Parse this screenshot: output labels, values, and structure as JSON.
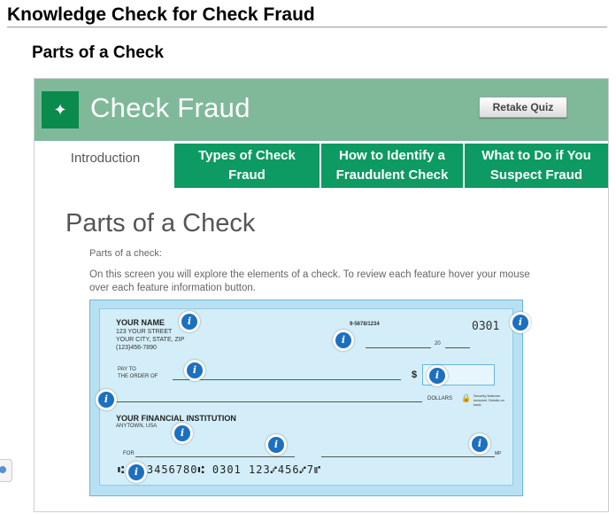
{
  "page": {
    "heading": "Knowledge Check for Check Fraud",
    "section_title": "Parts of a Check"
  },
  "banner": {
    "title": "Check Fraud",
    "retake_label": "Retake Quiz",
    "logo_icon": "bank-logo-icon",
    "color": "#7fb99a"
  },
  "tabs": [
    {
      "label": "Introduction",
      "active": true
    },
    {
      "label": "Types of Check Fraud",
      "active": false
    },
    {
      "label": "How to Identify a Fraudulent Check",
      "active": false
    },
    {
      "label": "What to Do if You Suspect Fraud",
      "active": false
    }
  ],
  "content": {
    "title": "Parts of a Check",
    "label": "Parts of a check:",
    "instructions": "On this screen you will explore the elements of a check. To review each feature hover your mouse over each feature information button."
  },
  "check": {
    "name": "YOUR NAME",
    "street": "123 YOUR STREET",
    "city": "YOUR CITY, STATE, ZIP",
    "phone": "(123)456-7890",
    "routing_fraction": "9-5678/1234",
    "date_suffix": "20",
    "check_number": "0301",
    "pay_to_line1": "PAY TO",
    "pay_to_line2": "THE ORDER OF",
    "dollar_sign": "$",
    "dollars_label": "DOLLARS",
    "security_text": "Security features included. Details on back.",
    "bank_name": "YOUR FINANCIAL INSTITUTION",
    "bank_location": "ANYTOWN, USA",
    "for_label": "FOR",
    "signature_suffix": "MP",
    "micr_line": "⑆ 123456780⑆ 0301 123⑇456⑇7⑈",
    "info_icon_glyph": "i"
  },
  "colors": {
    "tab_green": "#0d9a63",
    "check_bg": "#d3eef9",
    "info_blue": "#1d70c0"
  }
}
